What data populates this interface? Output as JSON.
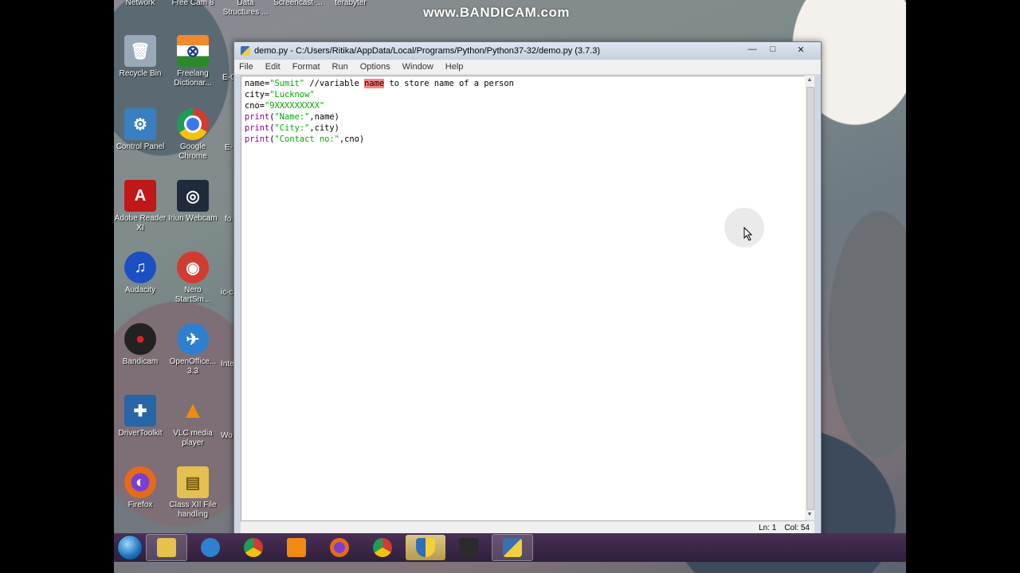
{
  "desktop": {
    "top_labels": [
      "Network",
      "Free Cam 8",
      "Data Structures ...",
      "Screencast-...",
      "terabyter"
    ],
    "watermark": "www.BANDICAM.com",
    "icons": [
      {
        "label": "Recycle Bin",
        "glyph": "🗑",
        "color": "#9aa9b8"
      },
      {
        "label": "Freelang Dictionar...",
        "glyph": "⊗",
        "color": "#e58a2c"
      },
      {
        "label": "Control Panel",
        "glyph": "⚙",
        "color": "#3a7fc1"
      },
      {
        "label": "Google Chrome",
        "glyph": "●",
        "color": "#d23b2f"
      },
      {
        "label": "Adobe Reader XI",
        "glyph": "A",
        "color": "#c01818"
      },
      {
        "label": "Iriun Webcam",
        "glyph": "◎",
        "color": "#1f2b3a"
      },
      {
        "label": "Audacity",
        "glyph": "♫",
        "color": "#1b4fc4"
      },
      {
        "label": "Nero StartSm...",
        "glyph": "◉",
        "color": "#d23b2f"
      },
      {
        "label": "Bandicam",
        "glyph": "●",
        "color": "#222222"
      },
      {
        "label": "OpenOffice... 3.3",
        "glyph": "✈",
        "color": "#2f7fd0"
      },
      {
        "label": "DriverToolkit",
        "glyph": "✚",
        "color": "#2866a8"
      },
      {
        "label": "VLC media player",
        "glyph": "▲",
        "color": "#f08a10"
      },
      {
        "label": "Firefox",
        "glyph": "◐",
        "color": "#e66a1a"
      },
      {
        "label": "Class XII File handling",
        "glyph": "▤",
        "color": "#e3c050"
      }
    ],
    "partial_labels": [
      "E-C",
      "E-",
      "fo",
      "ic-c",
      "Inte",
      "Wo"
    ]
  },
  "window": {
    "title": "demo.py - C:/Users/Ritika/AppData/Local/Programs/Python/Python37-32/demo.py (3.7.3)",
    "controls": {
      "minimize": "—",
      "maximize": "□",
      "close": "✕"
    },
    "menu": [
      "File",
      "Edit",
      "Format",
      "Run",
      "Options",
      "Window",
      "Help"
    ],
    "code": {
      "line1": {
        "a": "name=",
        "b": "\"Sumit\"",
        "c": " //variable ",
        "d": "name",
        "e": " to store name of a person"
      },
      "line2": {
        "a": "city=",
        "b": "\"Lucknow\""
      },
      "line3": {
        "a": "cno=",
        "b": "\"9XXXXXXXXX\""
      },
      "line4": {
        "a": "print",
        "b": "(",
        "c": "\"Name:\"",
        "d": ",name)"
      },
      "line5": {
        "a": "print",
        "b": "(",
        "c": "\"City:\"",
        "d": ",city)"
      },
      "line6": {
        "a": "print",
        "b": "(",
        "c": "\"Contact no:\"",
        "d": ",cno)"
      }
    },
    "status": {
      "line": "Ln: 1",
      "col": "Col: 54"
    }
  },
  "taskbar": {
    "items": [
      {
        "name": "explorer",
        "color": "#e6c24c",
        "state": "open"
      },
      {
        "name": "internet-explorer",
        "color": "#2f80d0",
        "state": "none"
      },
      {
        "name": "chrome",
        "color": "#d23b2f",
        "state": "none"
      },
      {
        "name": "media-player",
        "color": "#f08a10",
        "state": "none"
      },
      {
        "name": "firefox",
        "color": "#e66a1a",
        "state": "none"
      },
      {
        "name": "chrome-2",
        "color": "#d23b2f",
        "state": "none"
      },
      {
        "name": "security-shield",
        "color": "#2f6fb8",
        "state": "active"
      },
      {
        "name": "media-app",
        "color": "#2b2b2b",
        "state": "none"
      },
      {
        "name": "python-idle",
        "color": "#3a6fb0",
        "state": "open"
      }
    ]
  }
}
